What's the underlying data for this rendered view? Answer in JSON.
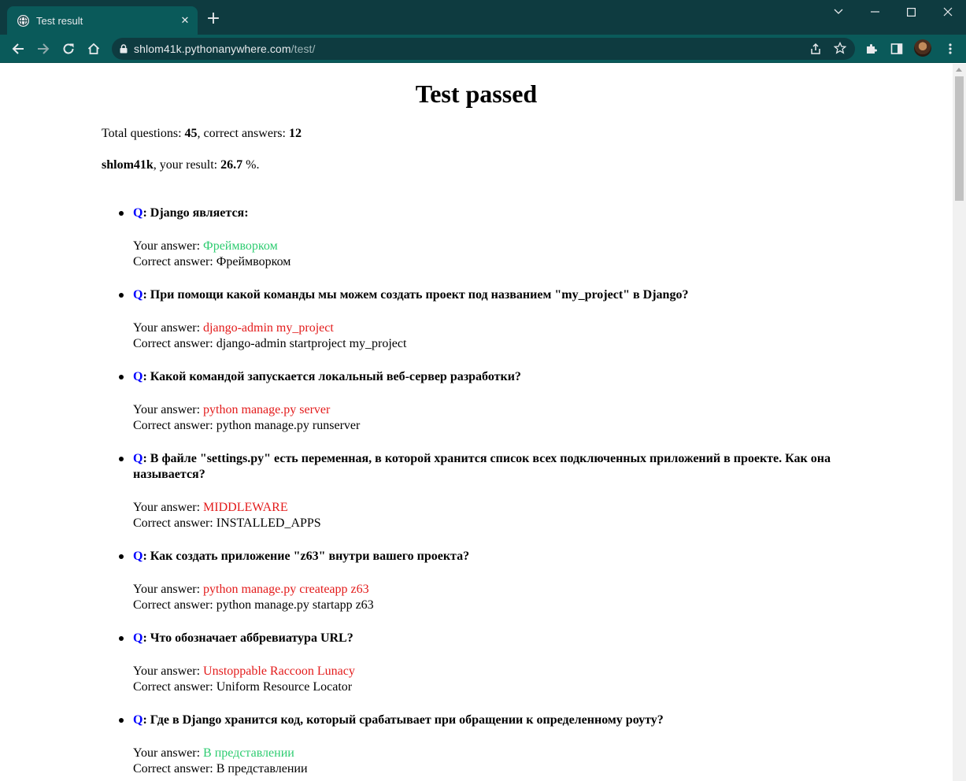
{
  "browser": {
    "tab_title": "Test result",
    "url_host": "shlom41k.pythonanywhere.com",
    "url_path": "/test/"
  },
  "page": {
    "heading": "Test passed",
    "total_label": "Total questions: ",
    "total_value": "45",
    "correct_label": ", correct answers: ",
    "correct_value": "12",
    "user": "shlom41k",
    "result_label": ", your result: ",
    "result_value": "26.7",
    "result_suffix": " %.",
    "q_prefix": "Q",
    "your_answer_label": "Your answer: ",
    "correct_answer_label": "Correct answer: ",
    "colors": {
      "correct": "#2ecc71",
      "wrong": "#e31b1b",
      "q_marker": "#0000ff"
    }
  },
  "questions": [
    {
      "question": "Django является:",
      "your_answer": "Фреймворком",
      "correct_answer": "Фреймворком",
      "is_correct": true
    },
    {
      "question": "При помощи какой команды мы можем создать проект под названием \"my_project\" в Django?",
      "your_answer": "django-admin my_project",
      "correct_answer": "django-admin startproject my_project",
      "is_correct": false
    },
    {
      "question": "Какой командой запускается локальный веб-сервер разработки?",
      "your_answer": "python manage.py server",
      "correct_answer": "python manage.py runserver",
      "is_correct": false
    },
    {
      "question": "В файле \"settings.py\" есть переменная, в которой хранится список всех подключенных приложений в проекте. Как она называется?",
      "your_answer": "MIDDLEWARE",
      "correct_answer": "INSTALLED_APPS",
      "is_correct": false
    },
    {
      "question": "Как создать приложение \"z63\" внутри вашего проекта?",
      "your_answer": "python manage.py createapp z63",
      "correct_answer": "python manage.py startapp z63",
      "is_correct": false
    },
    {
      "question": "Что обозначает аббревиатура URL?",
      "your_answer": "Unstoppable Raccoon Lunacy",
      "correct_answer": "Uniform Resource Locator",
      "is_correct": false
    },
    {
      "question": "Где в Django хранится код, который срабатывает при обращении к определенному роуту?",
      "your_answer": "В представлении",
      "correct_answer": "В представлении",
      "is_correct": true
    }
  ]
}
